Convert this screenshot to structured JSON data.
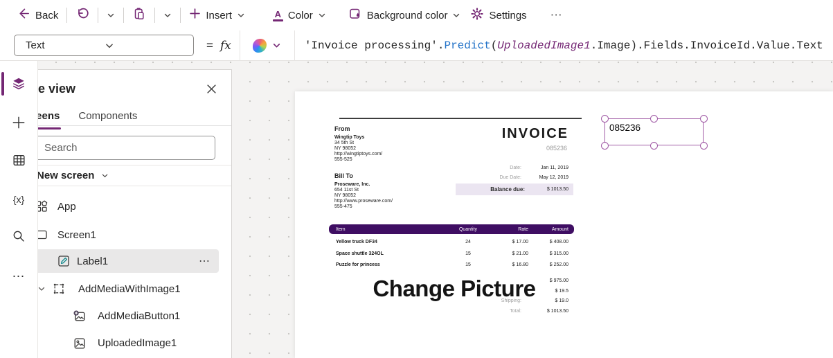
{
  "toolbar": {
    "back_label": "Back",
    "insert_label": "Insert",
    "color_label": "Color",
    "color_icon_letter": "A",
    "background_color_label": "Background color",
    "settings_label": "Settings",
    "more_glyph": "⋯"
  },
  "formula_bar": {
    "property_value": "Text",
    "equals_glyph": "=",
    "fx_glyph": "fx",
    "segments": [
      {
        "text": "'Invoice processing'",
        "color": "#242424"
      },
      {
        "text": ".",
        "color": "#242424"
      },
      {
        "text": "Predict",
        "color": "#2272c8"
      },
      {
        "text": "(",
        "color": "#242424"
      },
      {
        "text": "UploadedImage1",
        "color": "#742774"
      },
      {
        "text": ".Image)",
        "color": "#242424"
      },
      {
        "text": ".Fields.InvoiceId.Value.Text",
        "color": "#242424"
      }
    ]
  },
  "left_rail": {
    "plus_glyph": "+",
    "variables_glyph": "{x}",
    "more_glyph": "⋯"
  },
  "tree_view": {
    "title": "Tree view",
    "tabs": [
      {
        "label": "Screens"
      },
      {
        "label": "Components"
      }
    ],
    "search_placeholder": "Search",
    "new_screen_label": "New screen",
    "items": [
      {
        "label": "App"
      },
      {
        "label": "Screen1"
      },
      {
        "label": "Label1",
        "ellipsis_glyph": "⋯"
      },
      {
        "label": "AddMediaWithImage1"
      },
      {
        "label": "AddMediaButton1"
      },
      {
        "label": "UploadedImage1"
      }
    ]
  },
  "invoice": {
    "from_heading": "From",
    "from_lines": [
      "Wingtip Toys",
      "34 5th St",
      "NY 98052",
      "http://wingtiptoys.com/",
      "555-525"
    ],
    "title": "INVOICE",
    "number": "085236",
    "meta": [
      {
        "label": "Date:",
        "value": "Jan 11, 2019"
      },
      {
        "label": "Due Date:",
        "value": "May 12, 2019"
      }
    ],
    "balance_label": "Balance due:",
    "balance_value": "$ 1013.50",
    "bill_heading": "Bill To",
    "bill_lines": [
      "Proseware, Inc.",
      "654 11st St",
      "NY 98052",
      "http://www.proseware.com/",
      "555-475"
    ],
    "table": {
      "columns": [
        "Item",
        "Quantity",
        "Rate",
        "Amount"
      ],
      "rows": [
        [
          "Yellow truck DF34",
          "24",
          "$ 17.00",
          "$ 408.00"
        ],
        [
          "Space shuttle 324OL",
          "15",
          "$ 21.00",
          "$ 315.00"
        ],
        [
          "Puzzle for princess",
          "15",
          "$ 16.80",
          "$ 252.00"
        ]
      ]
    },
    "change_picture_label": "Change Picture",
    "totals": [
      {
        "label": "",
        "value": "$ 975.00"
      },
      {
        "label": "",
        "value": "$ 19.5"
      },
      {
        "label": "Shipping:",
        "value": "$ 19.0"
      },
      {
        "label": "Total:",
        "value": "$ 1013.50"
      }
    ]
  },
  "selected_label": {
    "text": "085236"
  },
  "colors": {
    "accent_purple": "#742774",
    "selection_purple": "#a05aa5",
    "table_header_purple": "#3f0e63",
    "balance_band": "#ebe5f1",
    "function_blue": "#2272c8"
  }
}
